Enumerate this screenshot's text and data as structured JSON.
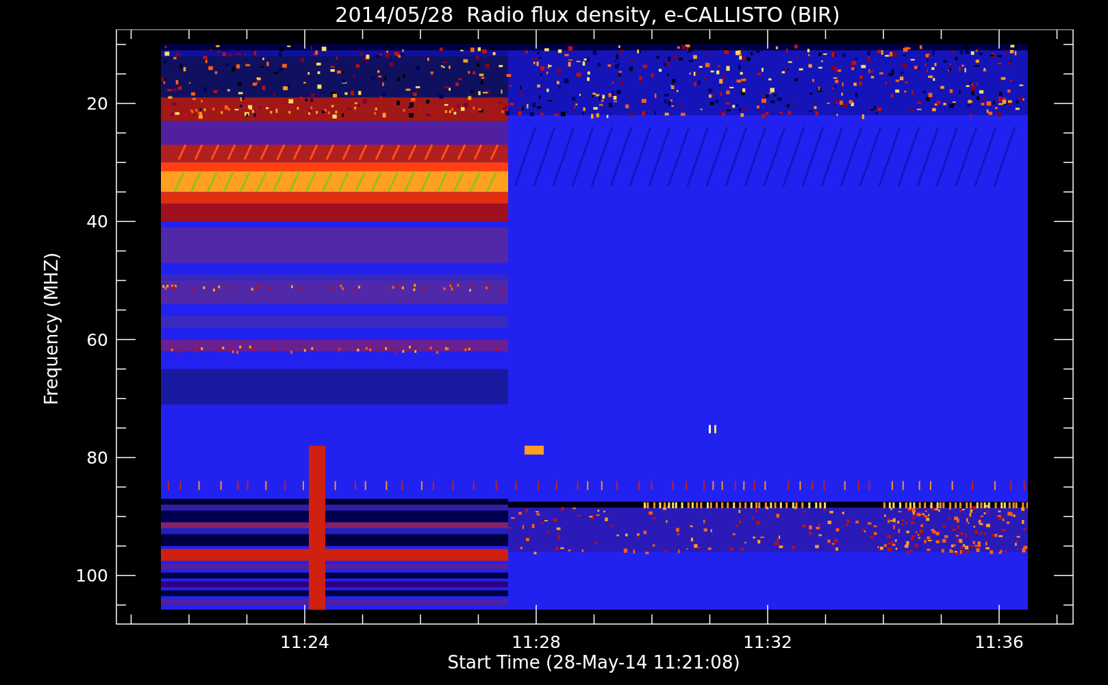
{
  "title": "2014/05/28  Radio flux density, e-CALLISTO (BIR)",
  "y_axis": {
    "label": "Frequency (MHZ)",
    "ticks": [
      "20",
      "40",
      "60",
      "80",
      "100"
    ]
  },
  "x_axis": {
    "label": "Start Time (28-May-14 11:21:08)",
    "ticks": [
      "11:24",
      "11:28",
      "11:32",
      "11:36"
    ]
  }
}
